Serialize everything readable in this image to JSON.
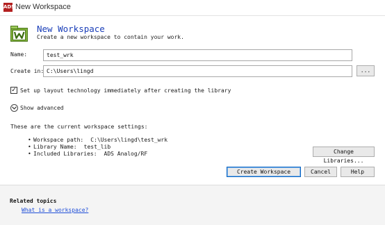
{
  "window": {
    "title": "New Workspace",
    "app_icon_text": "ADS"
  },
  "header": {
    "title": "New Workspace",
    "subtitle": "Create a new workspace to contain your work.",
    "icon": "workspace-w-icon"
  },
  "form": {
    "name_label": "Name:",
    "name_value": "test_wrk",
    "create_in_label": "Create in:",
    "create_in_value": "C:\\Users\\lingd",
    "browse_label": "...",
    "setup_layout_label": "Set up layout technology immediately after creating the library",
    "setup_layout_checked": true,
    "show_advanced_label": "Show advanced"
  },
  "settings": {
    "intro": "These are the current workspace settings:",
    "items": [
      {
        "label": "Workspace path:",
        "value": "C:\\Users\\lingd\\test_wrk"
      },
      {
        "label": "Library Name:",
        "value": "test_lib"
      },
      {
        "label": "Included Libraries:",
        "value": "ADS Analog/RF"
      }
    ],
    "change_libraries_label": "Change Libraries..."
  },
  "buttons": {
    "create": "Create Workspace",
    "cancel": "Cancel",
    "help": "Help"
  },
  "related": {
    "title": "Related topics",
    "link": "What is a workspace?"
  },
  "colors": {
    "heading": "#1a3eb8",
    "link": "#1f4ed8",
    "app_icon": "#b32020"
  }
}
